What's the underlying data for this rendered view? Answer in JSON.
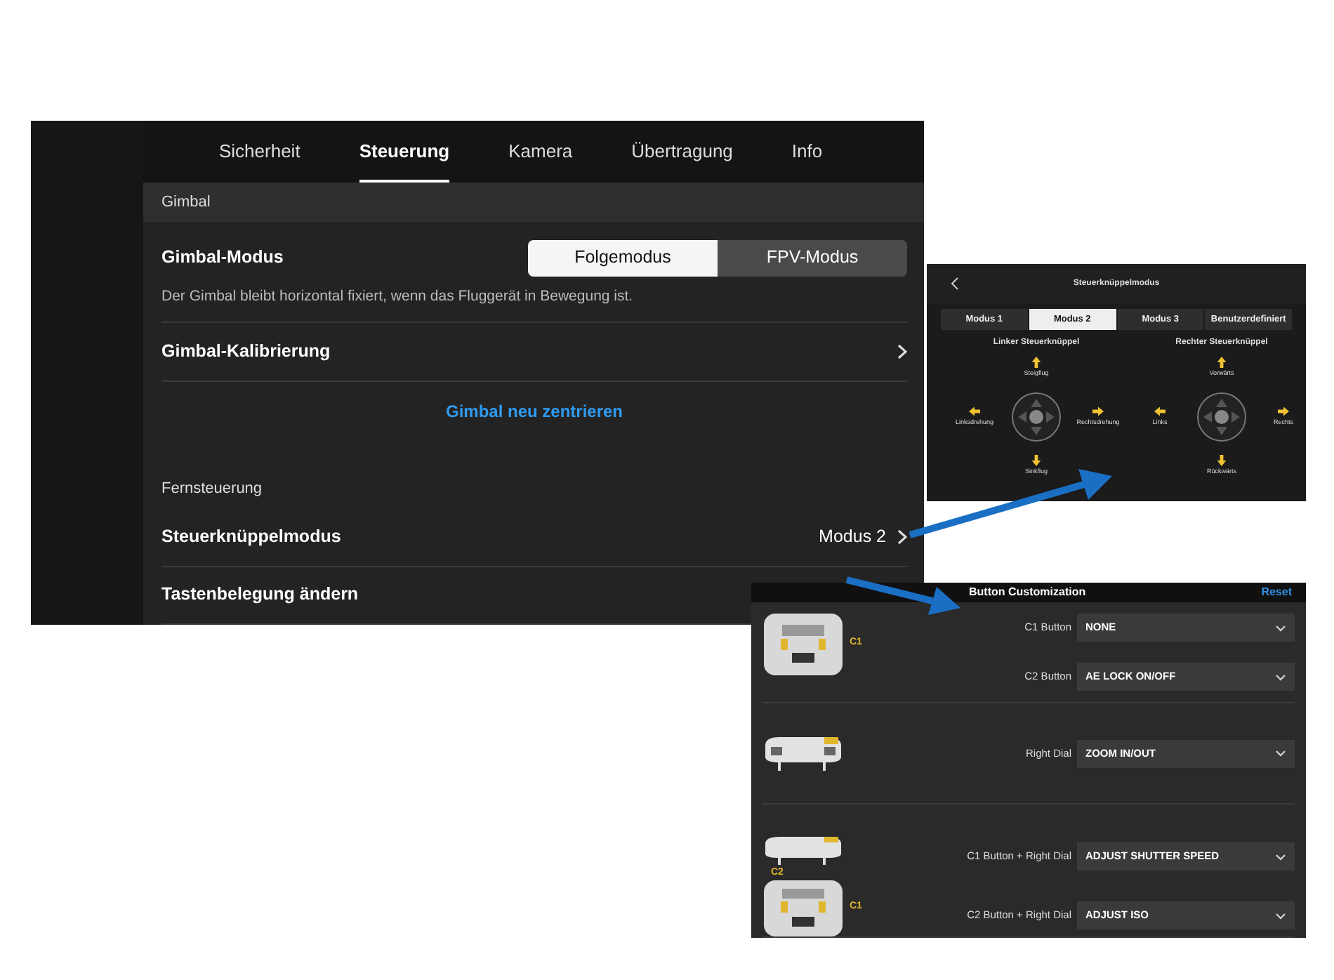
{
  "settings_window": {
    "tabs": [
      {
        "label": "Sicherheit",
        "selected": false
      },
      {
        "label": "Steuerung",
        "selected": true
      },
      {
        "label": "Kamera",
        "selected": false
      },
      {
        "label": "Übertragung",
        "selected": false
      },
      {
        "label": "Info",
        "selected": false
      }
    ],
    "sections": [
      {
        "header": "Gimbal",
        "rows": [
          {
            "kind": "segmented",
            "title": "Gimbal-Modus",
            "options": [
              {
                "label": "Folgemodus",
                "selected": true
              },
              {
                "label": "FPV-Modus",
                "selected": false
              }
            ],
            "description": "Der Gimbal bleibt horizontal fixiert, wenn das Fluggerät in Bewegung ist."
          },
          {
            "kind": "link",
            "title": "Gimbal-Kalibrierung"
          },
          {
            "kind": "action",
            "title": "Gimbal neu zentrieren"
          }
        ]
      },
      {
        "header": "Fernsteuerung",
        "rows": [
          {
            "kind": "value",
            "title": "Steuerknüppelmodus",
            "value": "Modus 2"
          },
          {
            "kind": "plain",
            "title": "Tastenbelegung ändern"
          }
        ]
      }
    ]
  },
  "stick_mode_window": {
    "title": "Steuerknüppelmodus",
    "modes": [
      {
        "label": "Modus 1",
        "selected": false
      },
      {
        "label": "Modus 2",
        "selected": true
      },
      {
        "label": "Modus 3",
        "selected": false
      },
      {
        "label": "Benutzerdefiniert",
        "selected": false
      }
    ],
    "sticks": [
      {
        "title": "Linker Steuerknüppel",
        "up": "Steigflug",
        "down": "Sinkflug",
        "left": "Linksdrehung",
        "right": "Rechtsdrehung"
      },
      {
        "title": "Rechter Steuerknüppel",
        "up": "Vorwärts",
        "down": "Rückwärts",
        "left": "Links",
        "right": "Rechts"
      }
    ]
  },
  "button_window": {
    "title": "Button Customization",
    "reset": "Reset",
    "groups": [
      {
        "kind": "back",
        "marks": [
          "C1"
        ],
        "rows": [
          {
            "label": "C1 Button",
            "value": "NONE"
          },
          {
            "label": "C2 Button",
            "value": "AE LOCK ON/OFF"
          }
        ]
      },
      {
        "kind": "top",
        "rows": [
          {
            "label": "Right Dial",
            "value": "ZOOM IN/OUT"
          }
        ]
      },
      {
        "kind": "both",
        "marks": [
          "C2",
          "C1"
        ],
        "rows": [
          {
            "label": "C1 Button + Right Dial",
            "value": "ADJUST SHUTTER SPEED"
          },
          {
            "label": "C2 Button + Right Dial",
            "value": "ADJUST ISO"
          }
        ]
      }
    ]
  }
}
